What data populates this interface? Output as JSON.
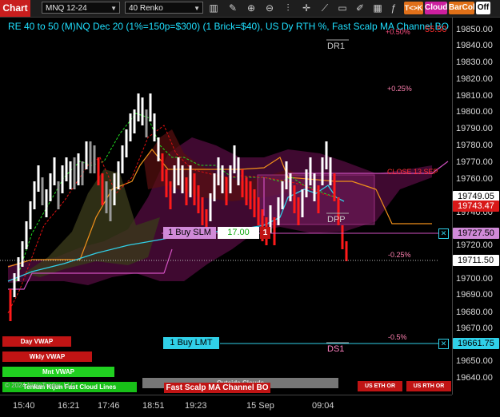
{
  "toolbar": {
    "chart_tab": "Chart",
    "instrument": "MNQ 12-24",
    "bar_type": "40 Renko",
    "tk_button": "T<>K",
    "cloud_button": "Cloud",
    "barcol_button": "BarCol",
    "off_button": "Off",
    "icons": [
      "bar-chart-icon",
      "pencil-icon",
      "zoom-in-icon",
      "zoom-out-icon",
      "chart-type-icon",
      "crosshair-icon",
      "drawing-icon",
      "folder-icon",
      "pencil-edit-icon",
      "data-box-icon",
      "indicator-icon"
    ]
  },
  "chart": {
    "title": "RE 40 to 50 (M)NQ Dec 20 (1%=150p=$300) (1 Brick=$40), US Dy RTH %, Fast Scalp MA Channel BO",
    "title_value": "55.50",
    "labels": {
      "pct_top": "+0.50%",
      "dr1": "DR1",
      "pct_pos": "+0.25%",
      "close": "CLOSE 13 SEP",
      "dpp": "DPP",
      "pct_neg1": "-0.25%",
      "pct_neg2": "-0.5%",
      "ds1": "DS1"
    },
    "orders": {
      "buy_slm_label": "1 Buy SLM",
      "buy_slm_value": "17.00",
      "buy_slm_qty": "1",
      "buy_lmt_label": "1 Buy LMT",
      "close_x": "✕"
    },
    "buttons": {
      "day_vwap": "Day VWAP",
      "wkly_vwap": "Wkly VWAP",
      "mnt_vwap": "Mnt VWAP",
      "tenkan": "Tenkan Kijun Fast Cloud Lines",
      "outside": "Outside Clouds",
      "fast_scalp": "Fast Scalp MA Channel BO",
      "us_eth": "US ETH OR",
      "us_rth": "US RTH OR",
      "copyright": "© 2024 NinjaTrader, LLC"
    },
    "colors": {
      "up_brick": "#ffffff",
      "down_brick": "#ff1a1a",
      "cloud": "#5a0a40",
      "channel": "#f0901a",
      "cyan": "#30d0e8"
    }
  },
  "price_axis": {
    "ticks": [
      "19850.00",
      "19840.00",
      "19830.00",
      "19820.00",
      "19810.00",
      "19800.00",
      "19790.00",
      "19780.00",
      "19770.00",
      "19760.00",
      "19740.00",
      "19720.00",
      "19700.00",
      "19690.00",
      "19680.00",
      "19670.00",
      "19650.00",
      "19640.00"
    ],
    "highlights": {
      "p1": "19749.05",
      "p2": "19743.47",
      "p3": "19727.50",
      "p4": "19711.50",
      "p5": "19661.75"
    }
  },
  "time_axis": [
    "15:40",
    "16:21",
    "17:46",
    "18:51",
    "19:23",
    "15 Sep",
    "09:04"
  ]
}
